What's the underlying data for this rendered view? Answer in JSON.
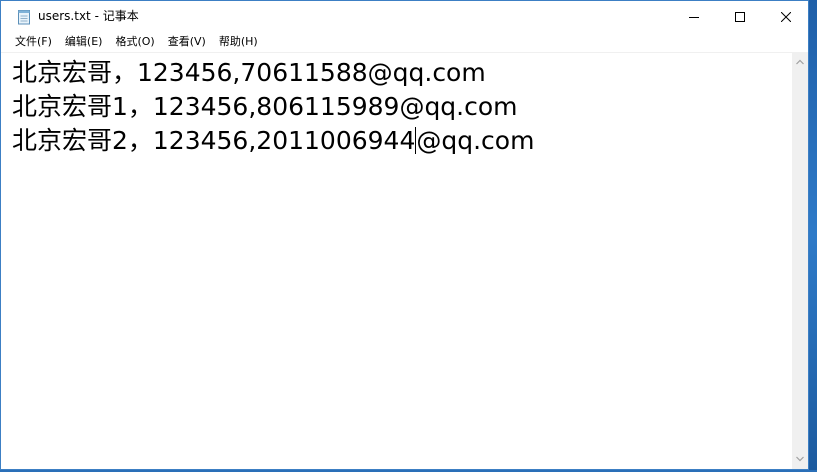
{
  "window": {
    "title": "users.txt - 记事本",
    "icon": "notepad-icon"
  },
  "title_buttons": {
    "minimize_icon": "minimize-icon",
    "maximize_icon": "maximize-icon",
    "close_icon": "close-icon"
  },
  "menu": {
    "items": [
      {
        "label": "文件(F)"
      },
      {
        "label": "编辑(E)"
      },
      {
        "label": "格式(O)"
      },
      {
        "label": "查看(V)"
      },
      {
        "label": "帮助(H)"
      }
    ]
  },
  "document": {
    "lines": [
      "北京宏哥，123456,70611588@qq.com",
      "北京宏哥1，123456,806115989@qq.com",
      "北京宏哥2，123456,2011006944",
      "@qq.com"
    ]
  },
  "colors": {
    "desktop": "#2a6fb8",
    "window_border": "#3c7fc4",
    "scrollbar_track": "#f0f0f0"
  }
}
